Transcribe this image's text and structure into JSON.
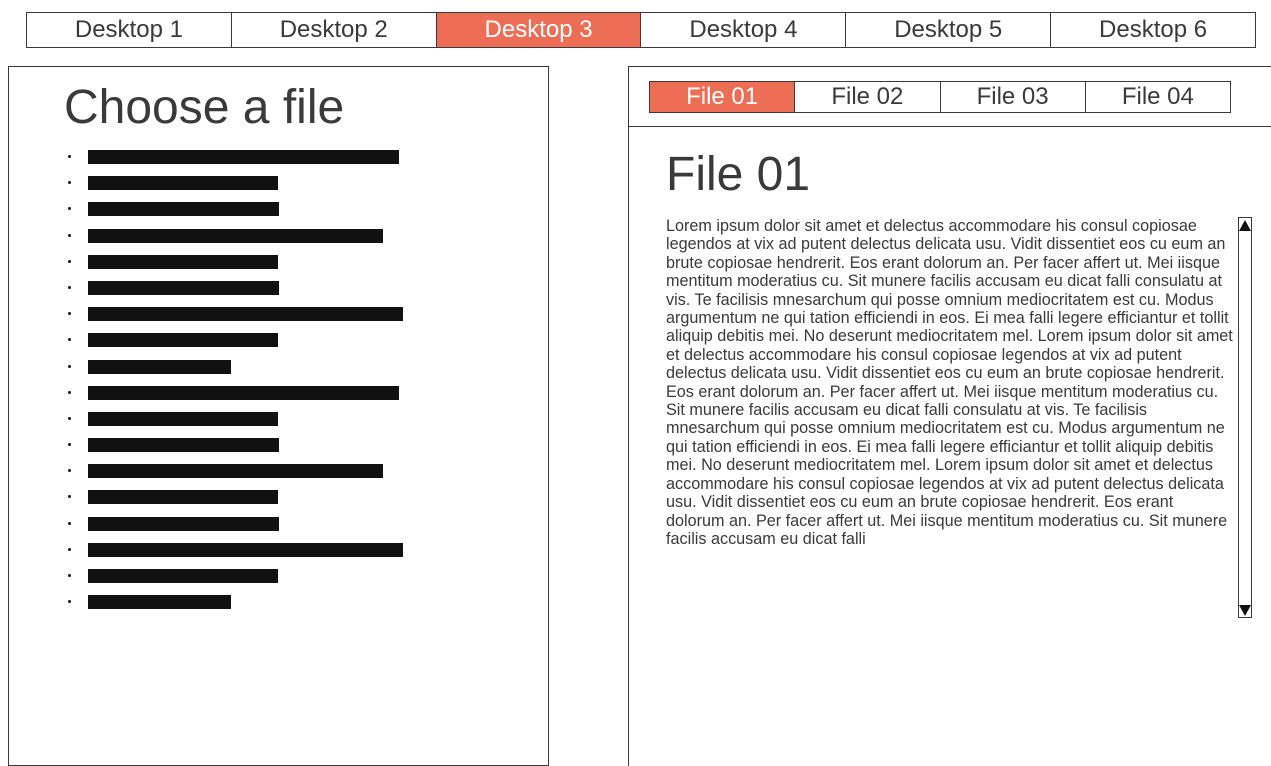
{
  "desktop_tabs": [
    {
      "label": "Desktop 1",
      "active": false
    },
    {
      "label": "Desktop 2",
      "active": false
    },
    {
      "label": "Desktop 3",
      "active": true
    },
    {
      "label": "Desktop 4",
      "active": false
    },
    {
      "label": "Desktop 5",
      "active": false
    },
    {
      "label": "Desktop 6",
      "active": false
    }
  ],
  "left_panel": {
    "title": "Choose a file",
    "item_count": 18
  },
  "right_panel": {
    "file_tabs": [
      {
        "label": "File 01",
        "active": true
      },
      {
        "label": "File 02",
        "active": false
      },
      {
        "label": "File 03",
        "active": false
      },
      {
        "label": "File 04",
        "active": false
      }
    ],
    "doc_title": "File 01",
    "doc_body": "Lorem ipsum dolor sit amet et delectus accommodare his consul copiosae legendos at vix ad putent delectus delicata usu. Vidit dissentiet eos cu eum an brute copiosae hendrerit. Eos erant dolorum an. Per facer affert ut. Mei iisque mentitum moderatius cu. Sit munere facilis accusam eu dicat falli consulatu at vis. Te facilisis mnesarchum qui posse omnium mediocritatem est cu. Modus argumentum ne qui tation efficiendi in eos. Ei mea falli legere efficiantur et tollit aliquip debitis mei. No deserunt mediocritatem mel. Lorem ipsum dolor sit amet et delectus accommodare his consul copiosae legendos at vix ad putent delectus delicata usu. Vidit dissentiet eos cu eum an brute copiosae hendrerit. Eos erant dolorum an. Per facer affert ut. Mei iisque mentitum moderatius cu. Sit munere facilis accusam eu dicat falli consulatu at vis. Te facilisis mnesarchum qui posse omnium mediocritatem est cu. Modus argumentum ne qui tation efficiendi in eos. Ei mea falli legere efficiantur et tollit aliquip debitis mei. No deserunt mediocritatem mel. Lorem ipsum dolor sit amet et delectus accommodare his consul copiosae legendos at vix ad putent delectus delicata usu. Vidit dissentiet eos cu eum an brute copiosae hendrerit. Eos erant dolorum an. Per facer affert ut. Mei iisque mentitum moderatius cu. Sit munere facilis accusam eu dicat falli"
  },
  "icons": {
    "scroll_up": "triangle-up-icon",
    "scroll_down": "triangle-down-icon"
  },
  "colors": {
    "accent": "#ee6e55",
    "text": "#3a3a3a",
    "bar": "#111111"
  }
}
